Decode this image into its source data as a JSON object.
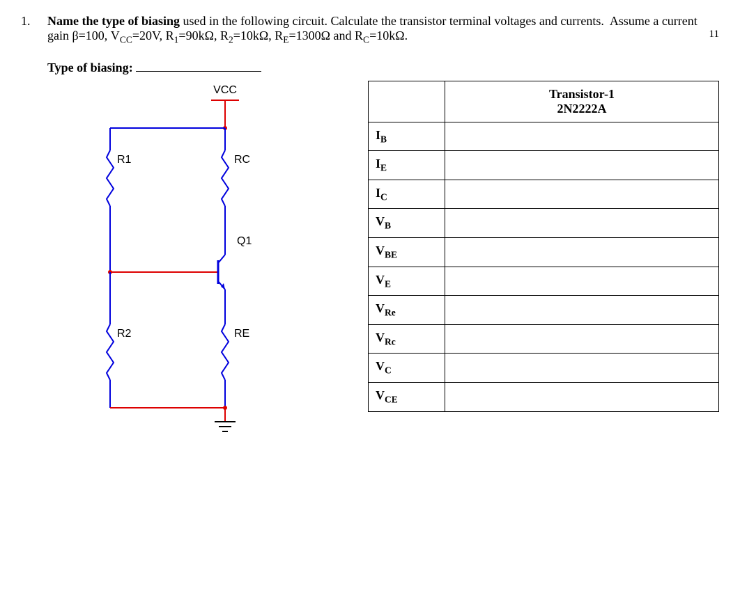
{
  "question": {
    "number": "1.",
    "prompt_html": "<b>Name the type of biasing</b> used in the following circuit. Calculate the transistor terminal voltages and currents.&nbsp; Assume a current gain β=100, V<sub>CC</sub>=20V, R<sub>1</sub>=90kΩ, R<sub>2</sub>=10kΩ, R<sub>E</sub>=1300Ω and R<sub>C</sub>=10kΩ.",
    "page_number": "11",
    "type_label": "Type of biasing:"
  },
  "circuit": {
    "label_vcc": "VCC",
    "label_r1": "R1",
    "label_r2": "R2",
    "label_rc": "RC",
    "label_re": "RE",
    "label_q1": "Q1"
  },
  "table": {
    "header_blank": "",
    "header_transistor": "Transistor-1\n2N2222A",
    "rows": [
      {
        "param_html": "I<sub>B</sub>",
        "value": ""
      },
      {
        "param_html": "I<sub>E</sub>",
        "value": ""
      },
      {
        "param_html": "I<sub>C</sub>",
        "value": ""
      },
      {
        "param_html": "V<sub>B</sub>",
        "value": ""
      },
      {
        "param_html": "V<sub>BE</sub>",
        "value": ""
      },
      {
        "param_html": "V<sub>E</sub>",
        "value": ""
      },
      {
        "param_html": "V<sub>Re</sub>",
        "value": ""
      },
      {
        "param_html": "V<sub>Rc</sub>",
        "value": ""
      },
      {
        "param_html": "V<sub>C</sub>",
        "value": ""
      },
      {
        "param_html": "V<sub>CE</sub>",
        "value": ""
      }
    ]
  }
}
